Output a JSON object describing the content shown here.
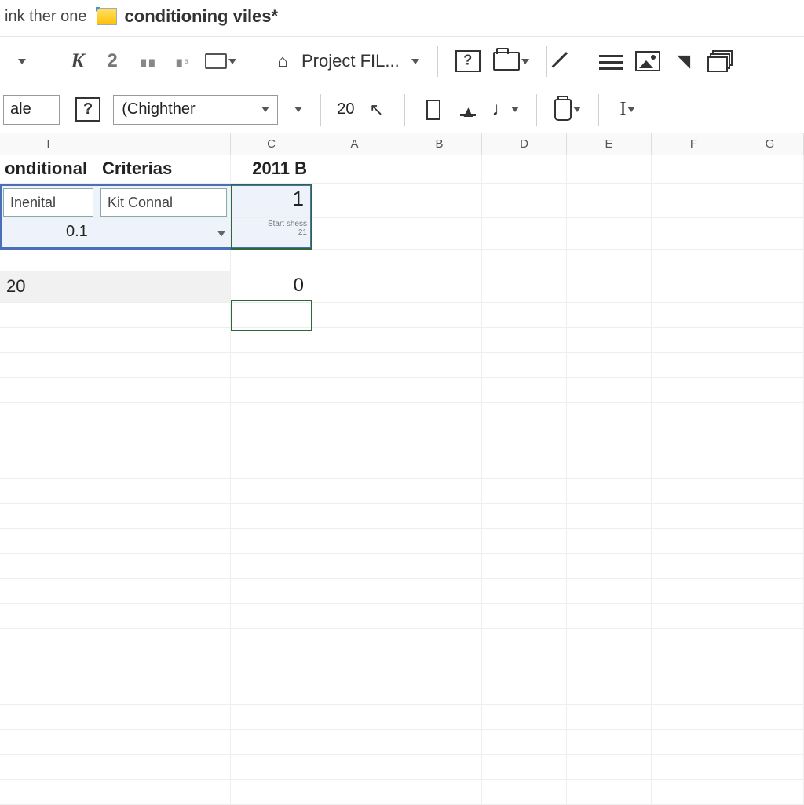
{
  "titlebar": {
    "prefix": "ink ther one",
    "filename": "conditioning viles*"
  },
  "toolbar1": {
    "project_label": "Project FIL..."
  },
  "toolbar2": {
    "cell_ref": "ale",
    "font_name": "(Chighther",
    "font_size": "20"
  },
  "colheaders": [
    "I",
    "",
    "C",
    "A",
    "B",
    "D",
    "E",
    "F",
    "G"
  ],
  "sheet": {
    "row1": {
      "c0": "onditional",
      "c1": "Criterias",
      "c2": "2011 B"
    },
    "row2": {
      "c0_input": "Inenital",
      "c1_input": "Kit Connal",
      "c2_val": "1"
    },
    "row3": {
      "c0c1_val": "0.1",
      "c2_note_a": "Start shess",
      "c2_note_b": "21"
    },
    "row5": {
      "c0": "20",
      "c2": "0"
    }
  }
}
